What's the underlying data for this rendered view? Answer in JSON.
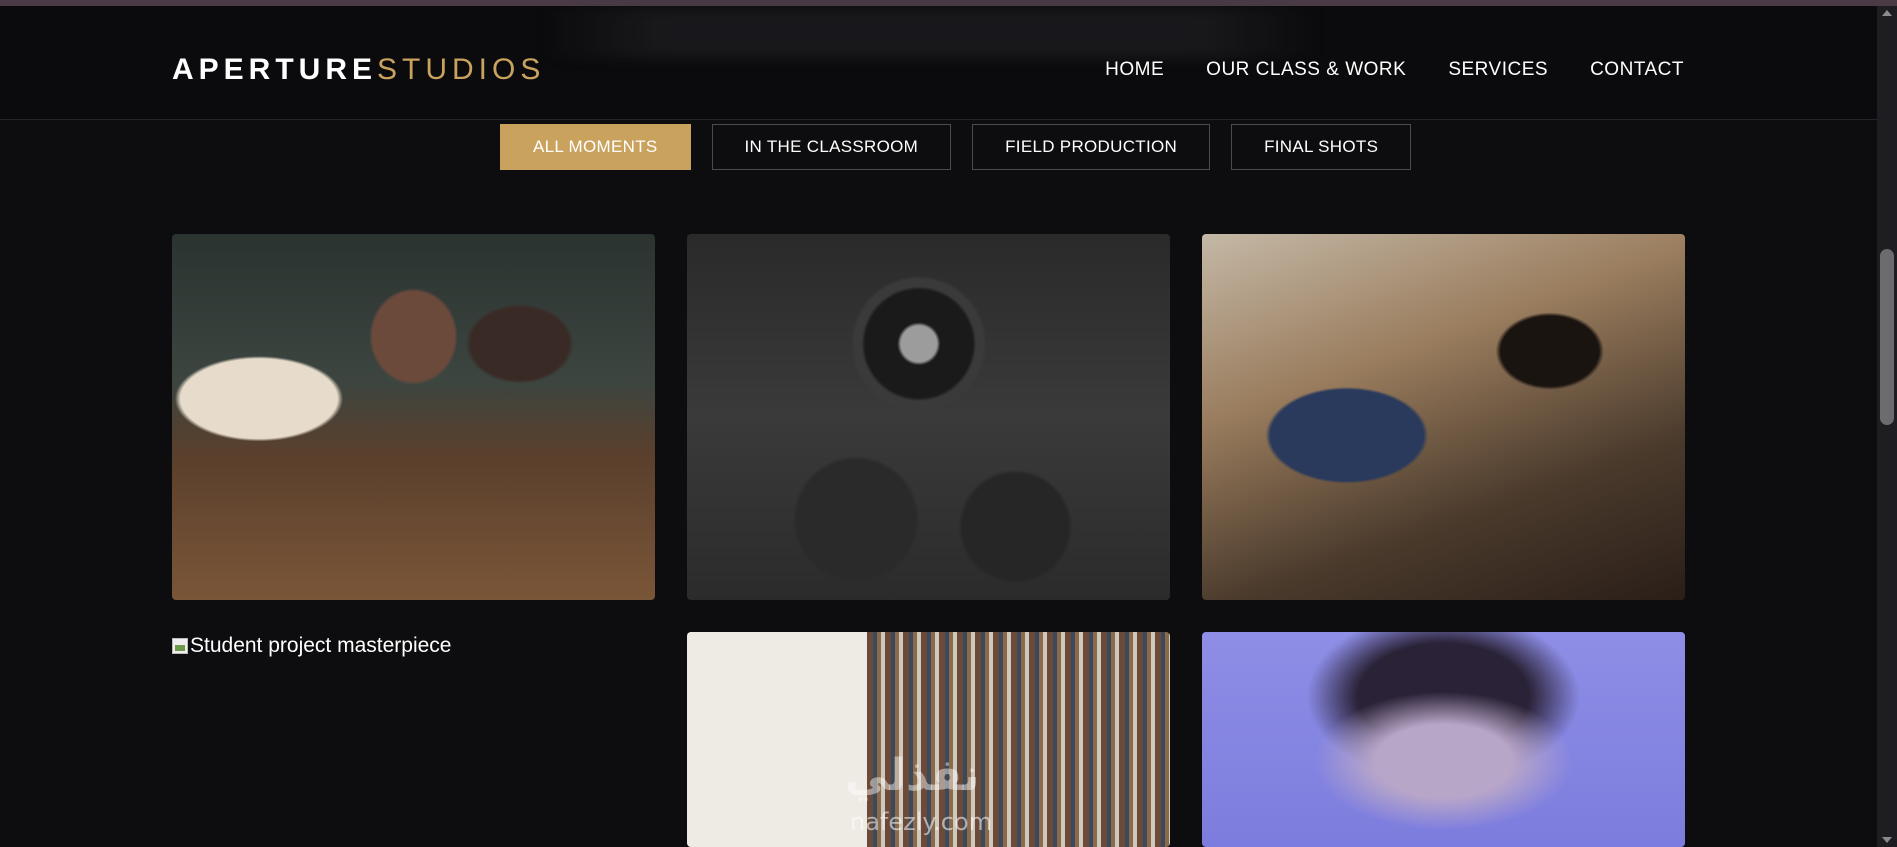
{
  "header": {
    "logo_part1": "APERTURE",
    "logo_part2": "STUDIOS",
    "nav": [
      {
        "label": "HOME"
      },
      {
        "label": "OUR CLASS & WORK"
      },
      {
        "label": "SERVICES"
      },
      {
        "label": "CONTACT"
      }
    ]
  },
  "filters": [
    {
      "label": "ALL MOMENTS",
      "active": true
    },
    {
      "label": "IN THE CLASSROOM",
      "active": false
    },
    {
      "label": "FIELD PRODUCTION",
      "active": false
    },
    {
      "label": "FINAL SHOTS",
      "active": false
    }
  ],
  "gallery": {
    "broken_image_alt": "Student project masterpiece"
  },
  "watermark": {
    "arabic": "نفذلي",
    "latin": "nafezly.com"
  },
  "colors": {
    "accent": "#c9a25e",
    "background": "#0d0d0f"
  }
}
